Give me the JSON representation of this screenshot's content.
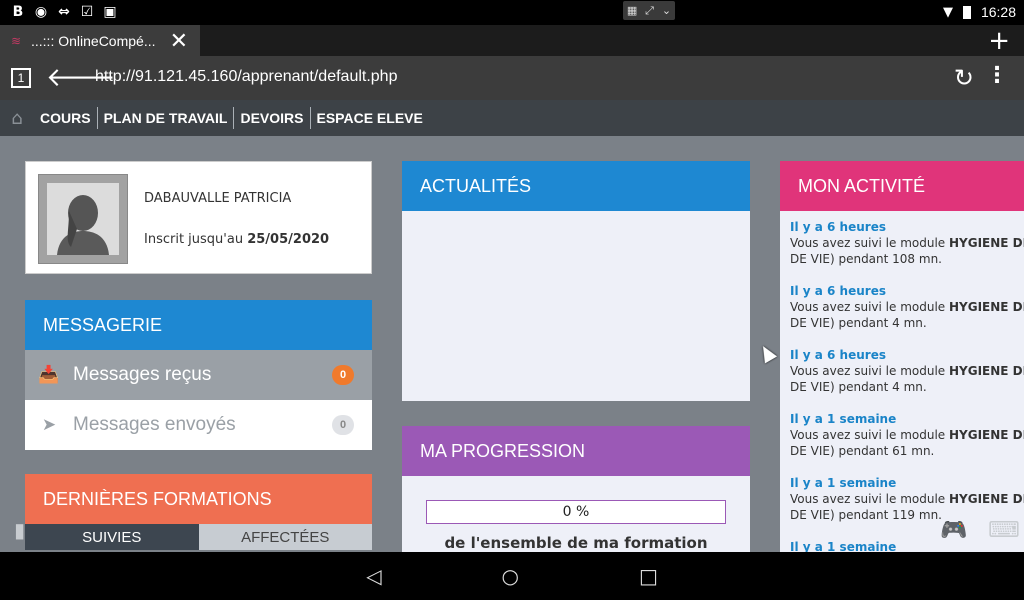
{
  "statusbar": {
    "left_icons": [
      "b-icon",
      "eye-icon",
      "teamviewer-icon",
      "clipboard-check-icon",
      "bag-icon"
    ],
    "clock": "16:28"
  },
  "browser": {
    "tab_title": "...::: OnlineCompé...",
    "url": "http://91.121.45.160/apprenant/default.php",
    "tab_count": "1"
  },
  "nav": {
    "items": [
      "COURS",
      "PLAN DE TRAVAIL",
      "DEVOIRS",
      "ESPACE ELEVE"
    ]
  },
  "profile": {
    "name": "DABAUVALLE PATRICIA",
    "enrolled_label": "Inscrit jusqu'au",
    "enrolled_date": "25/05/2020"
  },
  "messagerie": {
    "title": "MESSAGERIE",
    "received_label": "Messages reçus",
    "received_count": "0",
    "sent_label": "Messages envoyés",
    "sent_count": "0"
  },
  "formations": {
    "title": "DERNIÈRES FORMATIONS",
    "tab_followed": "SUIVIES",
    "tab_assigned": "AFFECTÉES"
  },
  "news": {
    "title": "ACTUALITÉS"
  },
  "progress": {
    "title": "MA PROGRESSION",
    "value_label": "0 %",
    "value": 0,
    "caption": "de l'ensemble de ma formation"
  },
  "activity": {
    "title": "MON ACTIVITÉ",
    "items": [
      {
        "when": "Il y a 6 heures",
        "prefix": "Vous avez suivi le module ",
        "module": "HYGIENE DE VI",
        "line2": "DE VIE) pendant 108 mn."
      },
      {
        "when": "Il y a 6 heures",
        "prefix": "Vous avez suivi le module ",
        "module": "HYGIENE DE VI",
        "line2": "DE VIE) pendant 4 mn."
      },
      {
        "when": "Il y a 6 heures",
        "prefix": "Vous avez suivi le module ",
        "module": "HYGIENE DE VI",
        "line2": "DE VIE) pendant 4 mn."
      },
      {
        "when": "Il y a 1 semaine",
        "prefix": "Vous avez suivi le module ",
        "module": "HYGIENE DE VI",
        "line2": "DE VIE) pendant 61 mn."
      },
      {
        "when": "Il y a 1 semaine",
        "prefix": "Vous avez suivi le module ",
        "module": "HYGIENE DE VI",
        "line2": "DE VIE) pendant 119 mn."
      },
      {
        "when": "Il y a 1 semaine",
        "prefix": "",
        "module": "",
        "line2": ""
      }
    ]
  },
  "colors": {
    "blue": "#1e88d2",
    "orange_badge": "#f07a2c",
    "coral": "#ef6f51",
    "purple": "#9b59b6",
    "pink": "#e0347a",
    "link_blue": "#1a84c8"
  }
}
